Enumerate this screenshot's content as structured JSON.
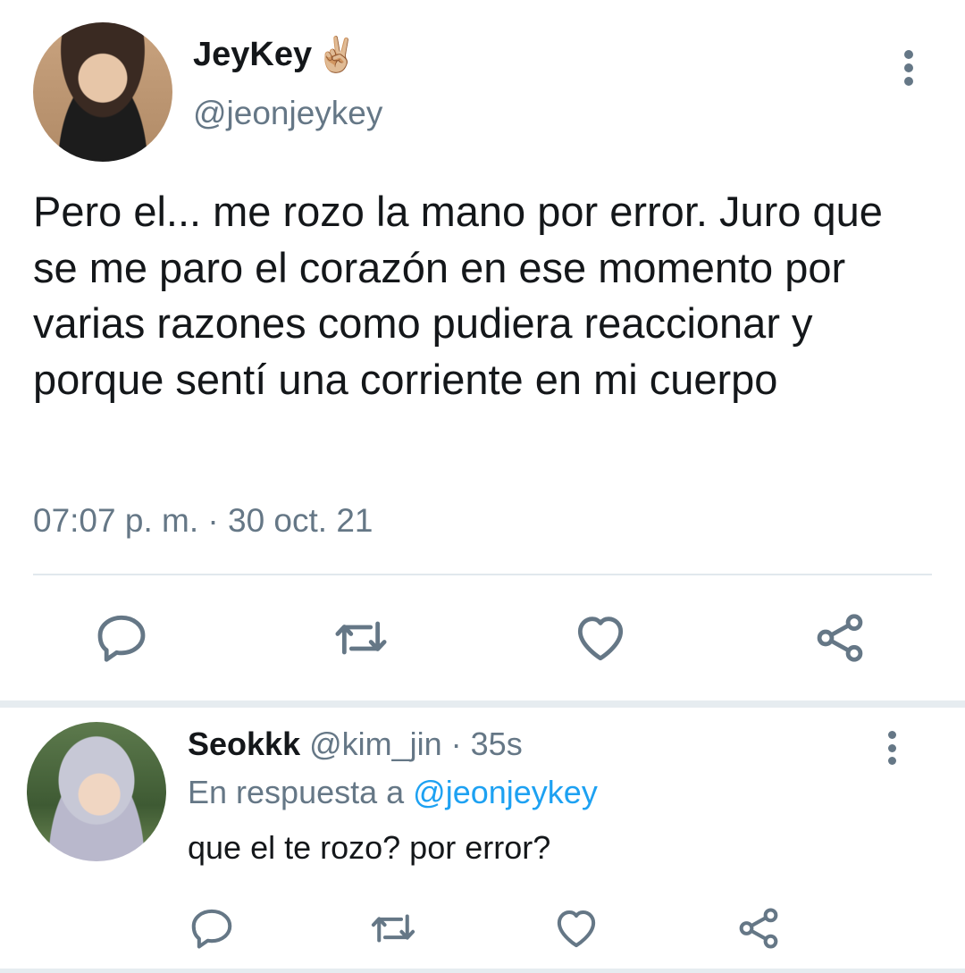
{
  "main_tweet": {
    "display_name": "JeyKey",
    "display_name_emoji": "✌🏼",
    "handle": "@jeonjeykey",
    "text": "Pero el... me rozo la mano por error. Juro que se me paro el corazón en ese momento por varias razones como pudiera reaccionar y porque sentí una corriente en mi cuerpo",
    "timestamp": "07:07 p. m. · 30 oct. 21",
    "actions": [
      "reply-icon",
      "retweet-icon",
      "like-icon",
      "share-icon"
    ]
  },
  "reply": {
    "display_name": "Seokkk",
    "handle_time": " @kim_jin · 35s",
    "reply_prefix": "En respuesta a ",
    "reply_to": "@jeonjeykey",
    "text": "que el te rozo? por error?",
    "actions": [
      "reply-icon",
      "retweet-icon",
      "like-icon",
      "share-icon"
    ]
  },
  "colors": {
    "primary_text": "#14171a",
    "secondary_text": "#657786",
    "link": "#1da1f2",
    "divider": "#e1e8ed"
  }
}
